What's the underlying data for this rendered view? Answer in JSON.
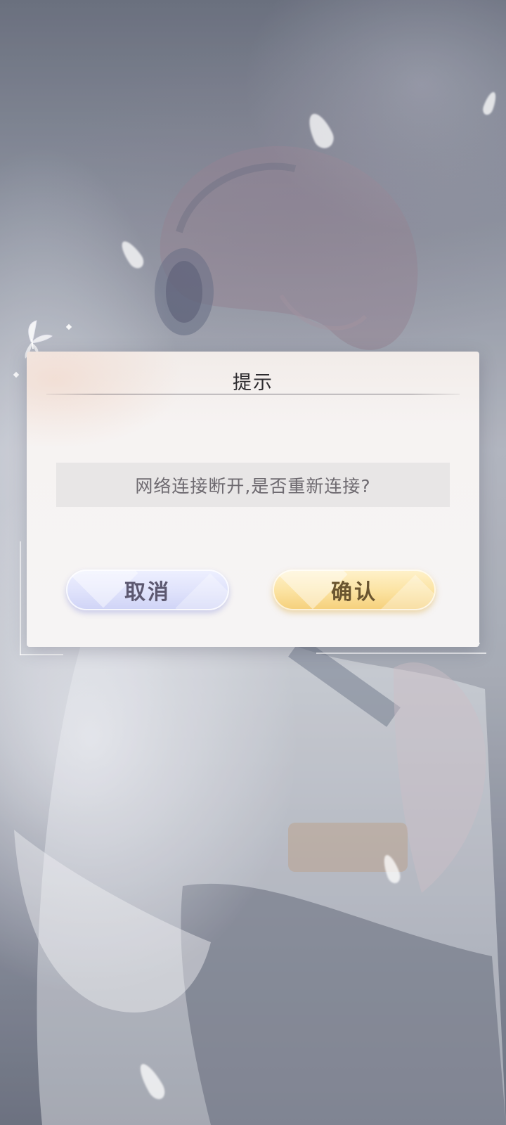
{
  "dialog": {
    "title": "提示",
    "message": "网络连接断开,是否重新连接?",
    "cancel_label": "取消",
    "confirm_label": "确认"
  },
  "colors": {
    "cancel_button": "#dfe2fb",
    "confirm_button": "#fbe2a0",
    "title_text": "#2e2c30",
    "message_text": "#6e6a70"
  },
  "icons": {
    "decoration": "butterfly-icon"
  }
}
